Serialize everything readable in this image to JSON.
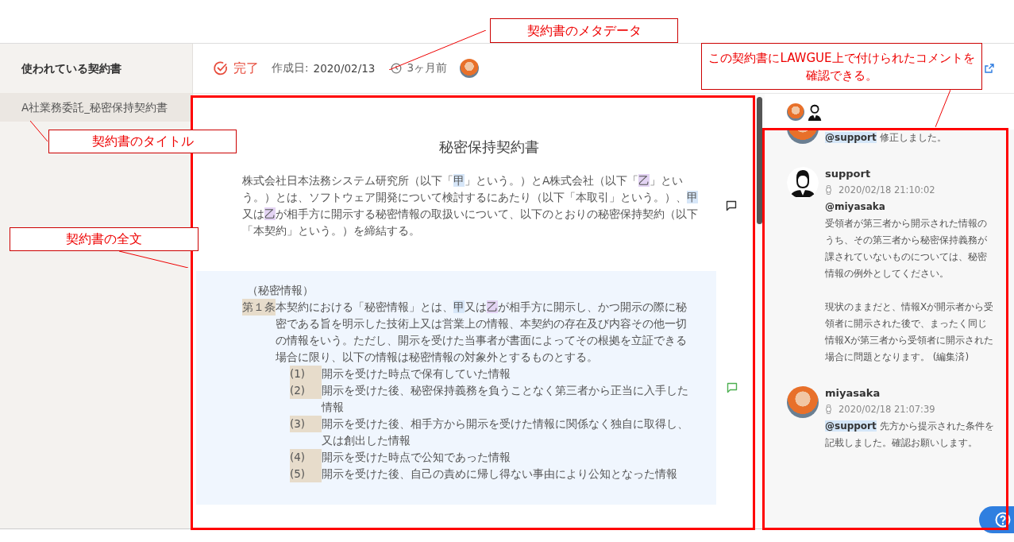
{
  "sidebar": {
    "heading": "使われている契約書",
    "items": [
      {
        "label": "A社業務委託_秘密保持契約書",
        "selected": true
      }
    ]
  },
  "header": {
    "status": "完了",
    "created_label": "作成日:",
    "created_date": "2020/02/13",
    "age": "3ヶ月前"
  },
  "document": {
    "title": "秘密保持契約書",
    "preamble": [
      {
        "kind": "plain",
        "text": "株式会社日本法務システム研究所（以下「"
      },
      {
        "kind": "party_a",
        "text": "甲"
      },
      {
        "kind": "plain",
        "text": "」という。）とA株式会社（以下「"
      },
      {
        "kind": "party_b",
        "text": "乙"
      },
      {
        "kind": "plain",
        "text": "」という。）とは、ソフトウェア開発について検討するにあたり（以下「本取引」という。）、"
      },
      {
        "kind": "party_a",
        "text": "甲"
      },
      {
        "kind": "plain",
        "text": "又は"
      },
      {
        "kind": "party_b",
        "text": "乙"
      },
      {
        "kind": "plain",
        "text": "が相手方に開示する秘密情報の取扱いについて、以下のとおりの秘密保持契約（以下「本契約」という。）を締結する。"
      }
    ],
    "preamble_commented": false,
    "article": {
      "caption": "（秘密情報）",
      "number": "第１条",
      "commented": true,
      "body": [
        {
          "kind": "plain",
          "text": "本契約における「秘密情報」とは、"
        },
        {
          "kind": "party_a",
          "text": "甲"
        },
        {
          "kind": "plain",
          "text": "又は"
        },
        {
          "kind": "party_b",
          "text": "乙"
        },
        {
          "kind": "plain",
          "text": "が相手方に開示し、かつ開示の際に秘密である旨を明示した技術上又は営業上の情報、本契約の存在及び内容その他一切の情報をいう。ただし、開示を受けた当事者が書面によってその根拠を立証できる場合に限り、以下の情報は秘密情報の対象外とするものとする。"
        }
      ],
      "items": [
        {
          "number": "(1)",
          "text": "開示を受けた時点で保有していた情報"
        },
        {
          "number": "(2)",
          "text": "開示を受けた後、秘密保持義務を負うことなく第三者から正当に入手した情報"
        },
        {
          "number": "(3)",
          "text": "開示を受けた後、相手方から開示を受けた情報に関係なく独自に取得し、又は創出した情報"
        },
        {
          "number": "(4)",
          "text": "開示を受けた時点で公知であった情報"
        },
        {
          "number": "(5)",
          "text": "開示を受けた後、自己の責めに帰し得ない事由により公知となった情報"
        }
      ]
    }
  },
  "comments": [
    {
      "kind": "photo",
      "paragraphs": [
        {
          "lines": [
            [
              {
                "kind": "mention",
                "text": "@support"
              },
              {
                "kind": "plain",
                "text": " 修正しました。"
              }
            ]
          ]
        }
      ]
    },
    {
      "kind": "silhouette",
      "author": "support",
      "time": "2020/02/18 21:10:02",
      "paragraphs": [
        {
          "lines": [
            [
              {
                "kind": "bold",
                "text": "@miyasaka"
              }
            ],
            [
              {
                "kind": "plain",
                "text": "受領者が第三者から開示された情報のうち、その第三者から秘密保持義務が課されていないものについては、秘密情報の例外としてください。"
              }
            ]
          ]
        },
        {
          "lines": [
            [
              {
                "kind": "plain",
                "text": "現状のままだと、情報Xが開示者から受領者に開示された後で、まったく同じ情報Xが第三者から受領者に開示された場合に問題となります。 (編集済)"
              }
            ]
          ]
        }
      ]
    },
    {
      "kind": "photo",
      "author": "miyasaka",
      "time": "2020/02/18 21:07:39",
      "paragraphs": [
        {
          "lines": [
            [
              {
                "kind": "mention",
                "text": "@support"
              },
              {
                "kind": "plain",
                "text": " 先方から提示された条件を記載しました。確認お願いします。"
              }
            ]
          ]
        }
      ]
    }
  ],
  "annotations": [
    {
      "text": "契約書のメタデータ"
    },
    {
      "text": "この契約書にLAWGUE上で付けられたコメントを確認できる。"
    },
    {
      "text": "契約書のタイトル"
    },
    {
      "text": "契約書の全文"
    }
  ]
}
